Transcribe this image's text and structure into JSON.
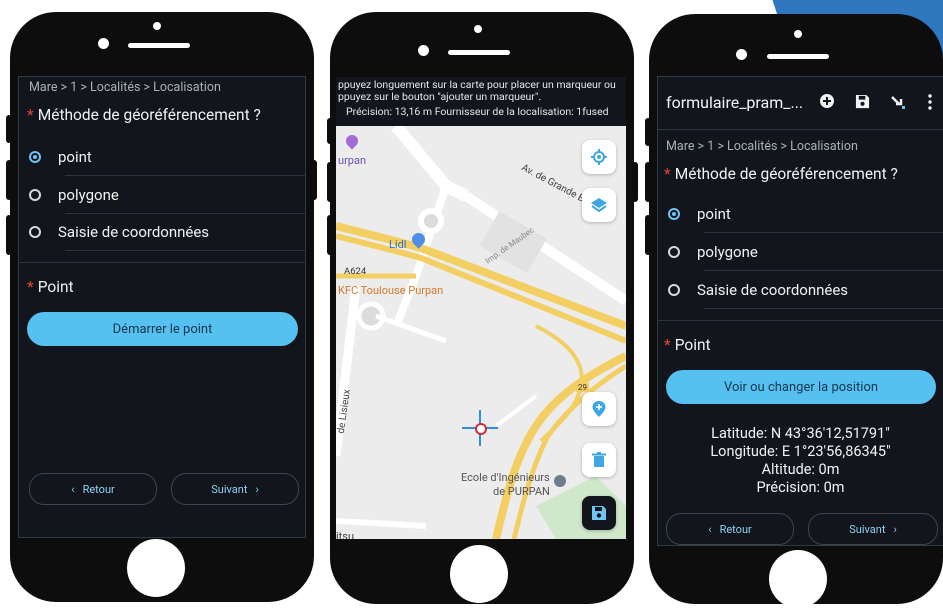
{
  "colors": {
    "accent": "#56c0f0",
    "required": "#e0433b",
    "screen_bg": "#12161c",
    "corner": "#2f78bf"
  },
  "phone1": {
    "breadcrumb": "Mare > 1 > Localités > Localisation",
    "question": "Méthode de géoréférencement ?",
    "options": [
      {
        "label": "point",
        "selected": true
      },
      {
        "label": "polygone",
        "selected": false
      },
      {
        "label": "Saisie de coordonnées",
        "selected": false
      }
    ],
    "section": "Point",
    "start_button": "Démarrer le point",
    "back_button": "Retour",
    "next_button": "Suivant"
  },
  "phone2": {
    "hint_line1": "ppuyez longuement sur la carte pour placer un marqueur ou",
    "hint_line2": "ppuyez sur le bouton \"ajouter un marqueur\".",
    "precision_line": "Précision: 13,16 m Fournisseur de la localisation: 1fused",
    "map_labels": {
      "purpan": "urpan",
      "avenue": "Av. de Grande Bretagne",
      "lidl": "Lidl",
      "impasse": "Imp. de Maubec",
      "a624": "A624",
      "kfc": "KFC Toulouse Purpan",
      "lisieux": "de Lisieux",
      "route_num": "29",
      "ecole1": "Ecole d'Ingénieurs",
      "ecole2": "de PURPAN",
      "itsu": "itsu"
    },
    "icons": [
      "my-location-icon",
      "layers-icon",
      "add-marker-icon",
      "delete-icon",
      "save-icon"
    ]
  },
  "phone3": {
    "title": "formulaire_pram_...",
    "breadcrumb": "Mare > 1 > Localités > Localisation",
    "question": "Méthode de géoréférencement ?",
    "options": [
      {
        "label": "point",
        "selected": true
      },
      {
        "label": "polygone",
        "selected": false
      },
      {
        "label": "Saisie de coordonnées",
        "selected": false
      }
    ],
    "section": "Point",
    "change_button": "Voir ou changer la position",
    "latitude": "Latitude: N 43°36'12,51791\"",
    "longitude": "Longitude: E 1°23'56,86345\"",
    "altitude": "Altitude: 0m",
    "precision": "Précision: 0m",
    "back_button": "Retour",
    "next_button": "Suivant"
  }
}
